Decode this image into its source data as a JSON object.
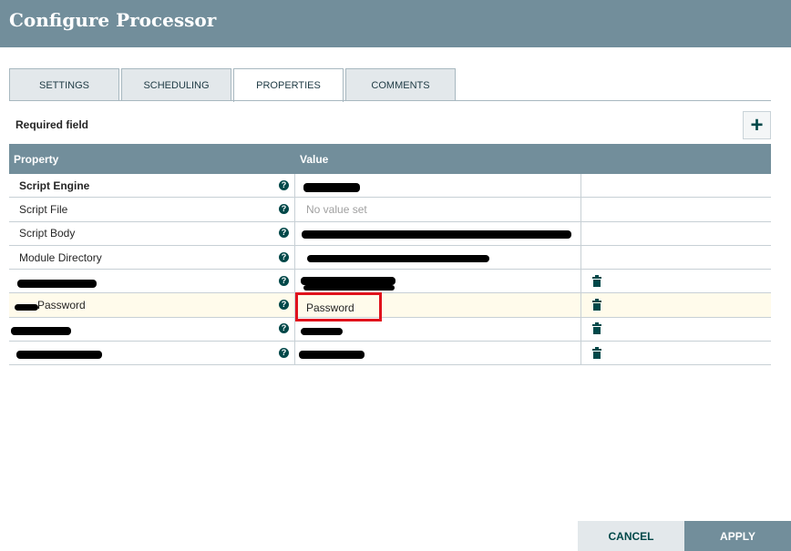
{
  "dialog": {
    "title": "Configure Processor"
  },
  "tabs": [
    {
      "label": "SETTINGS"
    },
    {
      "label": "SCHEDULING"
    },
    {
      "label": "PROPERTIES"
    },
    {
      "label": "COMMENTS"
    }
  ],
  "active_tab": "PROPERTIES",
  "required_field_label": "Required field",
  "grid": {
    "headers": {
      "property": "Property",
      "value": "Value"
    },
    "rows": [
      {
        "property": "Script Engine",
        "value": "",
        "required": true,
        "deletable": false
      },
      {
        "property": "Script File",
        "value": "No value set",
        "required": false,
        "deletable": false
      },
      {
        "property": "Script Body",
        "value": "",
        "required": false,
        "deletable": false
      },
      {
        "property": "Module Directory",
        "value": "",
        "required": false,
        "deletable": false
      },
      {
        "property": "",
        "value": "",
        "required": false,
        "deletable": true
      },
      {
        "property": "Password",
        "value": "Password",
        "required": false,
        "deletable": true
      },
      {
        "property": "",
        "value": "",
        "required": false,
        "deletable": true
      },
      {
        "property": "",
        "value": "",
        "required": false,
        "deletable": true
      }
    ]
  },
  "buttons": {
    "cancel": "CANCEL",
    "apply": "APPLY"
  },
  "icons": {
    "help": "?",
    "add": "+"
  },
  "colors": {
    "header": "#728e9b",
    "accent": "#004849",
    "highlight_row": "#fffbeb",
    "annotation": "#e0121c"
  }
}
